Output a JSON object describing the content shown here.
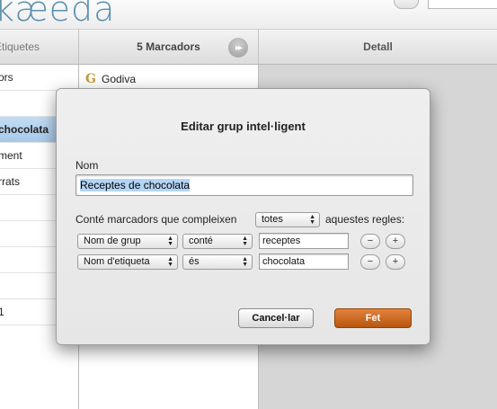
{
  "app": {
    "logo_text": "kæeda"
  },
  "columns": {
    "labels_header": "Etiquetes",
    "bookmarks_header": "5 Marcadors",
    "detail_header": "Detall"
  },
  "labels": [
    {
      "text": "ors"
    },
    {
      "text": ""
    },
    {
      "text": "chocolata",
      "selected": true
    },
    {
      "text": "ment"
    },
    {
      "text": "rrats"
    },
    {
      "text": ""
    },
    {
      "text": ""
    },
    {
      "text": ""
    },
    {
      "text": ""
    },
    {
      "text": "1"
    }
  ],
  "bookmarks": [
    {
      "title": "Godiva",
      "icon": "google-g-icon"
    }
  ],
  "dialog": {
    "title": "Editar grup intel·ligent",
    "name_label": "Nom",
    "name_value": "Receptes de chocolata",
    "rule_prefix": "Conté marcadors que compleixen",
    "match_value": "totes",
    "rule_suffix": "aquestes regles:",
    "rules": [
      {
        "field": "Nom de grup",
        "operator": "conté",
        "value": "receptes"
      },
      {
        "field": "Nom d'etiqueta",
        "operator": "és",
        "value": "chocolata"
      }
    ],
    "remove_label": "−",
    "add_label": "+",
    "cancel_label": "Cancel·lar",
    "done_label": "Fet",
    "accent_color": "#c4621a"
  }
}
